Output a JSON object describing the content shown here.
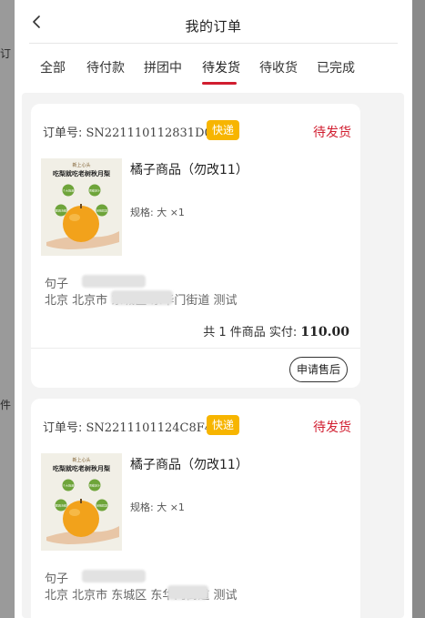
{
  "header": {
    "title": "我的订单"
  },
  "background": {
    "fragment_1": "订",
    "fragment_2": "件"
  },
  "tabs": [
    {
      "label": "全部"
    },
    {
      "label": "待付款"
    },
    {
      "label": "拼团中"
    },
    {
      "label": "待发货",
      "active": true
    },
    {
      "label": "待收货"
    },
    {
      "label": "已完成"
    }
  ],
  "orders": [
    {
      "order_no_label": "订单号:",
      "order_no": "SN221110112831D02B",
      "badge": "快递",
      "status": "待发货",
      "product": {
        "name": "橘子商品（勿改11）",
        "spec": "规格: 大 ×1",
        "image_banner": "新上心头",
        "image_title": "吃梨就吃老树秋月梨",
        "image_tags": [
          "个大饱满",
          "香甜多汁",
          "脆爽清甜",
          "采摘鲜发"
        ]
      },
      "recipient": "句子",
      "address": "北京 北京市 东城区 东华门街道 测试",
      "summary": {
        "prefix": "共 1 件商品 实付:",
        "total": "110.00"
      },
      "action": "申请售后"
    },
    {
      "order_no_label": "订单号:",
      "order_no": "SN2211101124C8F420",
      "badge": "快递",
      "status": "待发货",
      "product": {
        "name": "橘子商品（勿改11）",
        "spec": "规格: 大 ×1",
        "image_banner": "新上心头",
        "image_title": "吃梨就吃老树秋月梨",
        "image_tags": [
          "个大饱满",
          "香甜多汁",
          "脆爽清甜",
          "采摘鲜发"
        ]
      },
      "recipient": "句子",
      "address": "北京 北京市 东城区 东华门街道 测试"
    }
  ],
  "colors": {
    "accent": "#d11d2f",
    "badge": "#f7b500",
    "page_background": "#f3f3f3",
    "card": "#ffffff"
  }
}
